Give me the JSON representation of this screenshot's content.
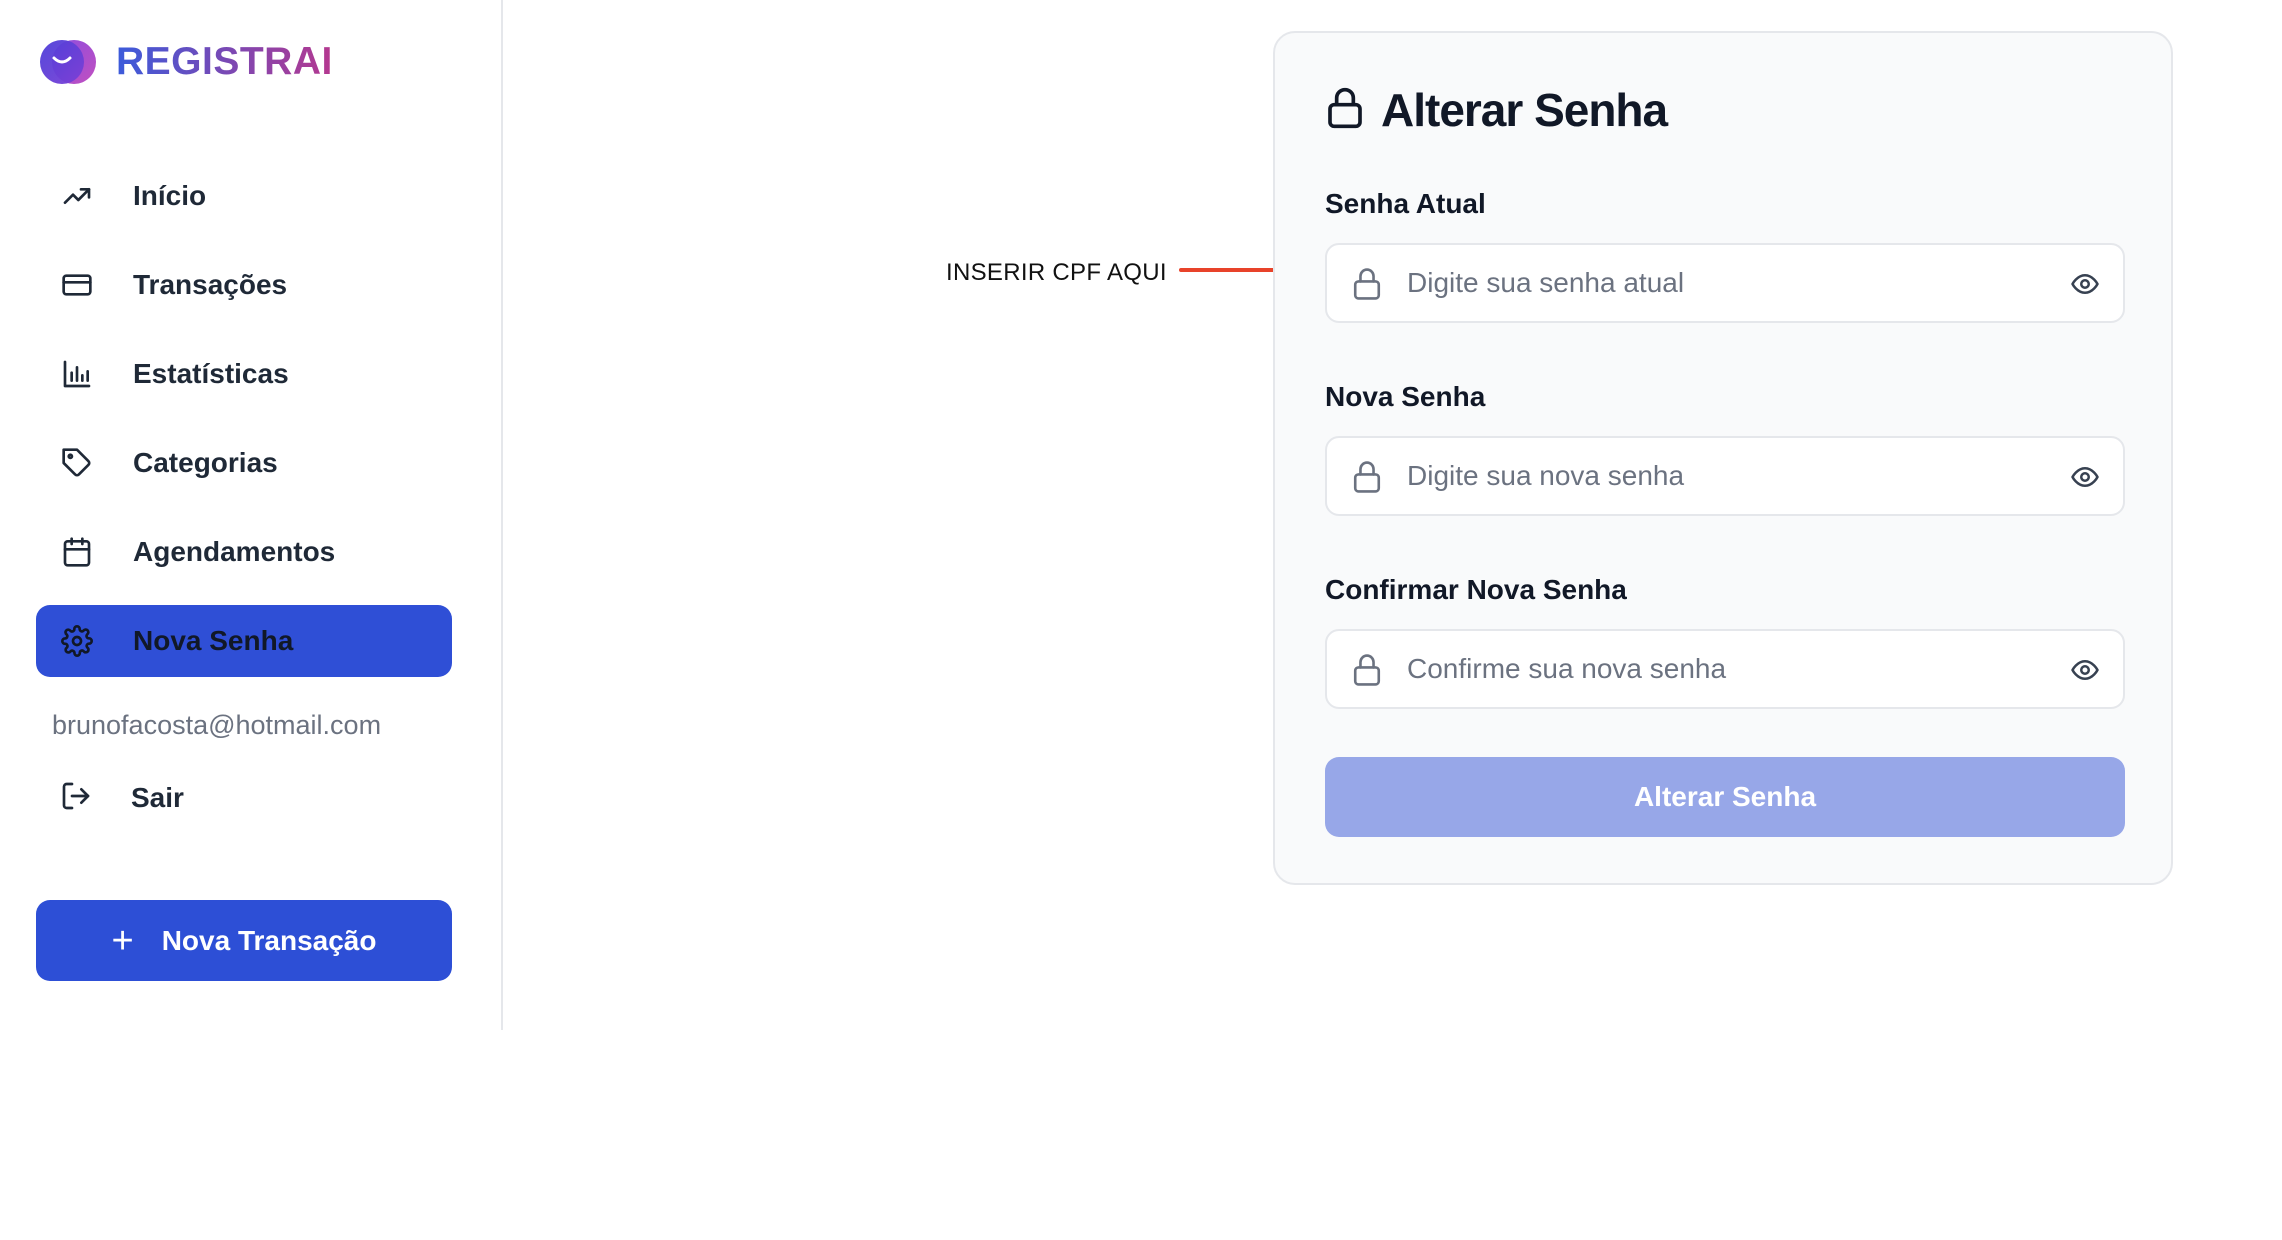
{
  "app": {
    "name": "REGISTRAI"
  },
  "sidebar": {
    "items": [
      {
        "label": "Início",
        "icon": "trending-up-icon"
      },
      {
        "label": "Transações",
        "icon": "credit-card-icon"
      },
      {
        "label": "Estatísticas",
        "icon": "bar-chart-icon"
      },
      {
        "label": "Categorias",
        "icon": "tag-icon"
      },
      {
        "label": "Agendamentos",
        "icon": "calendar-icon"
      },
      {
        "label": "Nova Senha",
        "icon": "gear-icon",
        "active": true
      }
    ],
    "user_email": "brunofacosta@hotmail.com",
    "logout_label": "Sair",
    "new_transaction_label": "Nova Transação"
  },
  "annotation": {
    "text": "INSERIR CPF AQUI",
    "color": "#e8432a"
  },
  "form": {
    "title": "Alterar Senha",
    "fields": [
      {
        "label": "Senha Atual",
        "placeholder": "Digite sua senha atual",
        "value": ""
      },
      {
        "label": "Nova Senha",
        "placeholder": "Digite sua nova senha",
        "value": ""
      },
      {
        "label": "Confirmar Nova Senha",
        "placeholder": "Confirme sua nova senha",
        "value": ""
      }
    ],
    "submit_label": "Alterar Senha",
    "submit_disabled": true
  },
  "colors": {
    "primary": "#2d4fd6",
    "primary_disabled": "#97a7e8",
    "logo_gradient_start": "#3b5bdb",
    "logo_gradient_end": "#b5388f"
  }
}
